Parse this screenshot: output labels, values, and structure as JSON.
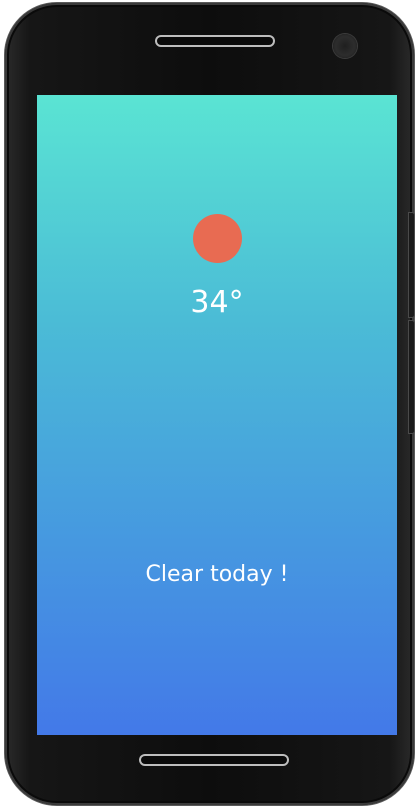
{
  "weather": {
    "temperature": "34°",
    "description": "Clear today !",
    "condition_icon": "sun-icon",
    "sun_color": "#e86b52",
    "gradient_top": "#5ae4d3",
    "gradient_bottom": "#4379e8"
  }
}
